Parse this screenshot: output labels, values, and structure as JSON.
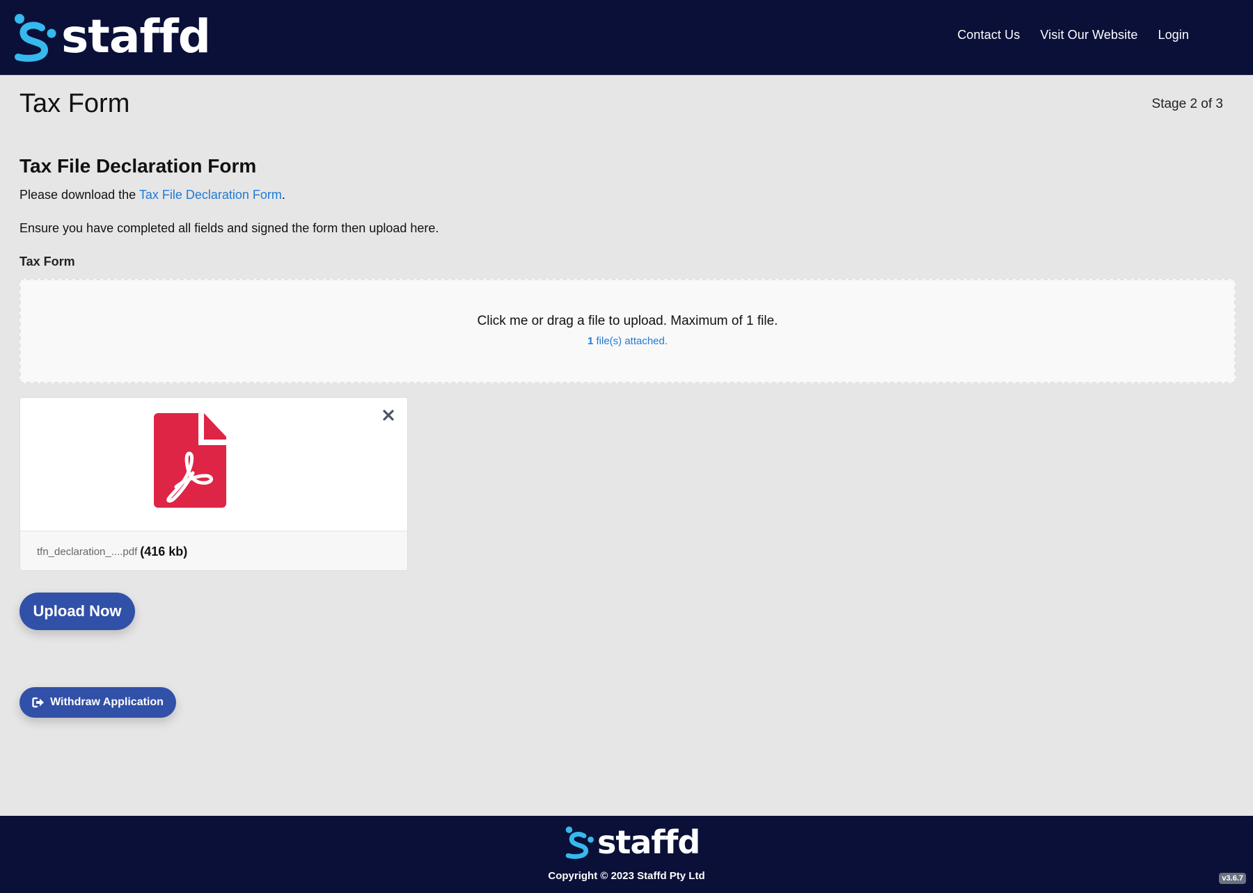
{
  "header": {
    "brand": "staffd",
    "logo_icon": "staffd-logo-icon",
    "nav": [
      {
        "label": "Contact Us"
      },
      {
        "label": "Visit Our Website"
      },
      {
        "label": "Login"
      }
    ]
  },
  "main": {
    "page_title": "Tax Form",
    "stage": "Stage 2 of 3",
    "section_title": "Tax File Declaration Form",
    "download_prefix": "Please download the ",
    "download_link": "Tax File Declaration Form",
    "download_suffix": ".",
    "instruction": "Ensure you have completed all fields and signed the form then upload here.",
    "field_label": "Tax Form",
    "dropzone": {
      "text": "Click me or drag a file to upload. Maximum of 1 file.",
      "attached_count": "1",
      "attached_suffix": " file(s) attached."
    },
    "file": {
      "icon": "pdf-file-icon",
      "name": "tfn_declaration_....pdf",
      "size": "(416 kb)"
    },
    "upload_button": "Upload Now",
    "withdraw_button": "Withdraw Application",
    "withdraw_icon": "sign-out-icon"
  },
  "footer": {
    "brand": "staffd",
    "copyright": "Copyright © 2023 Staffd Pty Ltd",
    "version": "v3.6.7"
  },
  "colors": {
    "header_bg": "#0a1038",
    "brand_accent": "#36b9ec",
    "button_primary": "#3150a8",
    "link": "#1f7ad6",
    "pdf_red": "#de2546",
    "page_bg": "#e6e6e6"
  }
}
